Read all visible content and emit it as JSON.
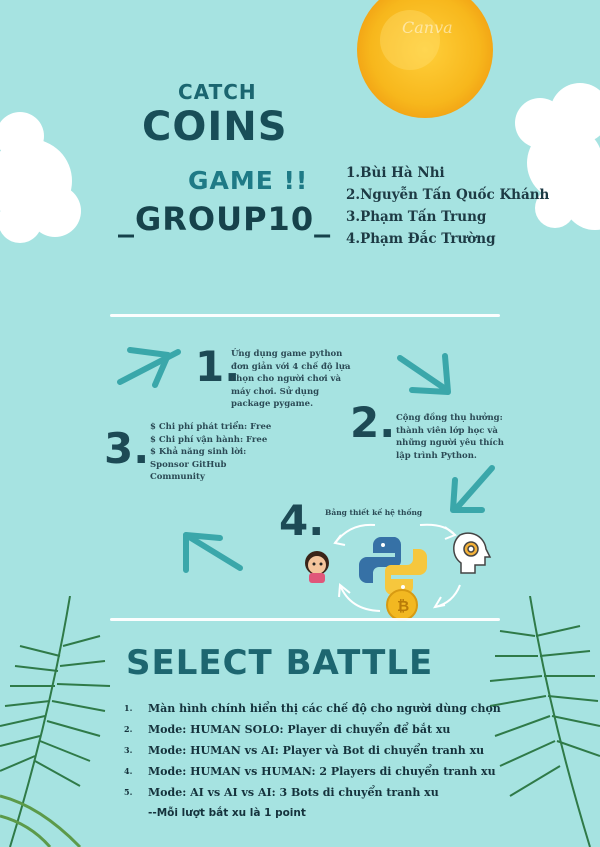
{
  "title": {
    "line1": "CATCH",
    "line2": "COINS",
    "line3": "GAME !!",
    "line4": "_GROUP10_"
  },
  "members": [
    "1.Bùi Hà Nhi",
    "2.Nguyễn Tấn Quốc Khánh",
    "3.Phạm Tấn Trung",
    "4.Phạm Đắc Trường"
  ],
  "steps": {
    "one": {
      "num": "1.",
      "text": "Ứng dụng game python đơn giản với 4 chế độ lựa chọn cho người chơi và máy chơi. Sử dụng package pygame."
    },
    "two": {
      "num": "2.",
      "text": "Cộng đồng thụ hưởng: thành viên lớp học và những người yêu thích lập trình Python."
    },
    "three": {
      "num": "3.",
      "lines": [
        "$ Chi phí phát triển: Free",
        "$ Chi phí vận hành: Free",
        "$ Khả năng sinh lời: Sponsor GitHub Community"
      ]
    },
    "four": {
      "num": "4.",
      "caption": "Bảng thiết kế hệ thống"
    }
  },
  "battle": {
    "heading": "SELECT BATTLE",
    "items": [
      {
        "n": "1.",
        "text": "Màn hình chính hiển thị các chế độ cho người dùng chọn"
      },
      {
        "n": "2.",
        "text": "Mode: HUMAN SOLO: Player di chuyển để bắt xu"
      },
      {
        "n": "3.",
        "text": "Mode: HUMAN vs AI: Player và Bot di chuyển tranh xu"
      },
      {
        "n": "4.",
        "text": "Mode: HUMAN vs HUMAN: 2 Players di chuyển tranh xu"
      },
      {
        "n": "5.",
        "text": "Mode: AI vs AI vs AI: 3 Bots di chuyển tranh xu"
      }
    ],
    "note": "--Mỗi lượt bắt xu là 1 point"
  },
  "watermark": "Canva",
  "colors": {
    "background": "#a6e3e1",
    "title": "#1b6670",
    "accent": "#3aa7aa",
    "dark": "#1d4a55"
  }
}
